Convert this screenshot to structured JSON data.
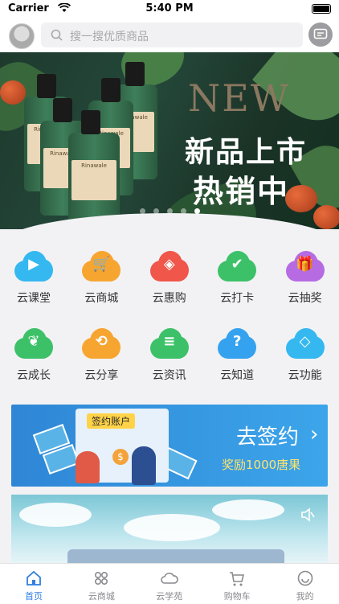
{
  "status_bar": {
    "carrier": "Carrier",
    "time": "5:40 PM"
  },
  "header": {
    "search_placeholder": "搜一搜优质商品"
  },
  "banner": {
    "headline_en": "NEW",
    "headline_cn_1": "新品上市",
    "headline_cn_2": "热销中",
    "product_brand": "Rinawale",
    "page_count": 5,
    "active_page": 5
  },
  "menu": [
    {
      "label": "云课堂",
      "icon": "play-icon",
      "color": "#35b8f0"
    },
    {
      "label": "云商城",
      "icon": "cart-icon",
      "color": "#f7a531"
    },
    {
      "label": "云惠购",
      "icon": "tag-icon",
      "color": "#f0564a"
    },
    {
      "label": "云打卡",
      "icon": "calendar-check-icon",
      "color": "#3dc168"
    },
    {
      "label": "云抽奖",
      "icon": "gift-icon",
      "color": "#b66be3"
    },
    {
      "label": "云成长",
      "icon": "sprout-icon",
      "color": "#3dc168"
    },
    {
      "label": "云分享",
      "icon": "share-icon",
      "color": "#f7a531"
    },
    {
      "label": "云资讯",
      "icon": "news-icon",
      "color": "#3dc168"
    },
    {
      "label": "云知道",
      "icon": "question-icon",
      "color": "#35a2f0"
    },
    {
      "label": "云功能",
      "icon": "cube-icon",
      "color": "#35b8f0"
    }
  ],
  "promo": {
    "title": "去签约",
    "arrow": "›",
    "reward": "奖励1000唐果",
    "card_title": "签约账户"
  },
  "tabbar": [
    {
      "label": "首页",
      "icon": "home-icon",
      "active": true
    },
    {
      "label": "云商城",
      "icon": "grid-icon",
      "active": false
    },
    {
      "label": "云学苑",
      "icon": "cloud-icon",
      "active": false
    },
    {
      "label": "购物车",
      "icon": "cart-icon",
      "active": false
    },
    {
      "label": "我的",
      "icon": "smile-icon",
      "active": false
    }
  ],
  "colors": {
    "accent": "#2f7ee0",
    "promo_bg": "#3ca5ea"
  }
}
